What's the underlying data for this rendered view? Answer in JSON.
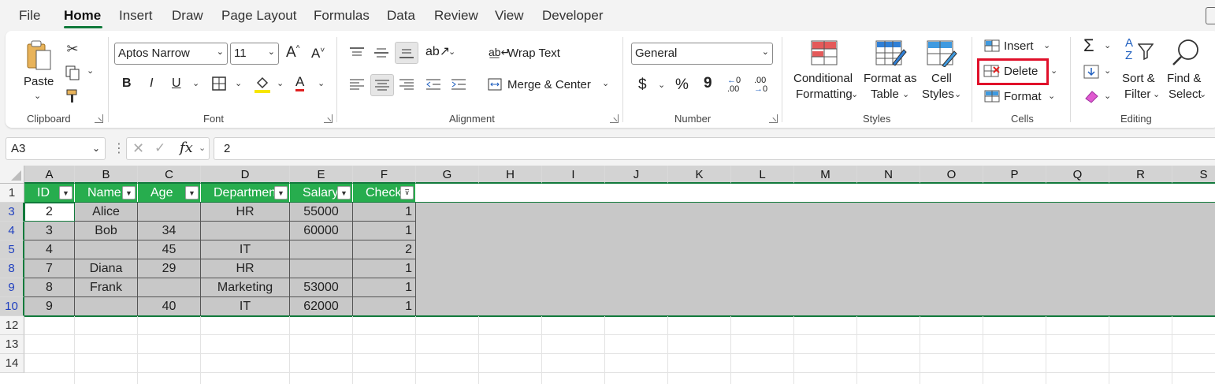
{
  "menu": {
    "tabs": [
      "File",
      "Home",
      "Insert",
      "Draw",
      "Page Layout",
      "Formulas",
      "Data",
      "Review",
      "View",
      "Developer"
    ],
    "active": "Home"
  },
  "ribbon": {
    "clipboard": {
      "paste": "Paste",
      "label": "Clipboard"
    },
    "font": {
      "name": "Aptos Narrow",
      "size": "11",
      "label": "Font",
      "bold": "B",
      "italic": "I",
      "underline": "U",
      "increase": "A^",
      "decrease": "A˅",
      "color": "A"
    },
    "alignment": {
      "wrap": "Wrap Text",
      "merge": "Merge & Center",
      "label": "Alignment"
    },
    "number": {
      "format": "General",
      "currency": "$",
      "percent": "%",
      "comma": "9",
      "label": "Number",
      "inc_decimal": ".00",
      "dec_decimal": ".00"
    },
    "styles": {
      "conditional_1": "Conditional",
      "conditional_2": "Formatting",
      "format_table_1": "Format as",
      "format_table_2": "Table",
      "cell_styles_1": "Cell",
      "cell_styles_2": "Styles",
      "label": "Styles"
    },
    "cells": {
      "insert": "Insert",
      "delete": "Delete",
      "format": "Format",
      "label": "Cells"
    },
    "editing": {
      "sort_1": "Sort &",
      "sort_2": "Filter",
      "find_1": "Find &",
      "find_2": "Select",
      "label": "Editing"
    }
  },
  "formula_bar": {
    "name_box": "A3",
    "fx": "fx",
    "value": "2"
  },
  "sheet": {
    "columns": [
      "A",
      "B",
      "C",
      "D",
      "E",
      "F",
      "G",
      "H",
      "I",
      "J",
      "K",
      "L",
      "M",
      "N",
      "O",
      "P",
      "Q",
      "R",
      "S"
    ],
    "header_row": {
      "row": "1",
      "cells": [
        "ID",
        "Name",
        "Age",
        "Department",
        "Salary",
        "Check"
      ]
    },
    "rows": [
      {
        "row": "3",
        "cells": [
          "2",
          "Alice",
          "",
          "HR",
          "55000",
          "1"
        ]
      },
      {
        "row": "4",
        "cells": [
          "3",
          "Bob",
          "34",
          "",
          "60000",
          "1"
        ]
      },
      {
        "row": "5",
        "cells": [
          "4",
          "",
          "45",
          "IT",
          "",
          "2"
        ]
      },
      {
        "row": "8",
        "cells": [
          "7",
          "Diana",
          "29",
          "HR",
          "",
          "1"
        ]
      },
      {
        "row": "9",
        "cells": [
          "8",
          "Frank",
          "",
          "Marketing",
          "53000",
          "1"
        ]
      },
      {
        "row": "10",
        "cells": [
          "9",
          "",
          "40",
          "IT",
          "62000",
          "1"
        ]
      }
    ],
    "empty_rows": [
      "12",
      "13",
      "14"
    ]
  },
  "colors": {
    "accent": "#127a3c",
    "header_fill": "#27ad4e",
    "selection": "#c8c8c8",
    "highlight": "#e0102a"
  }
}
